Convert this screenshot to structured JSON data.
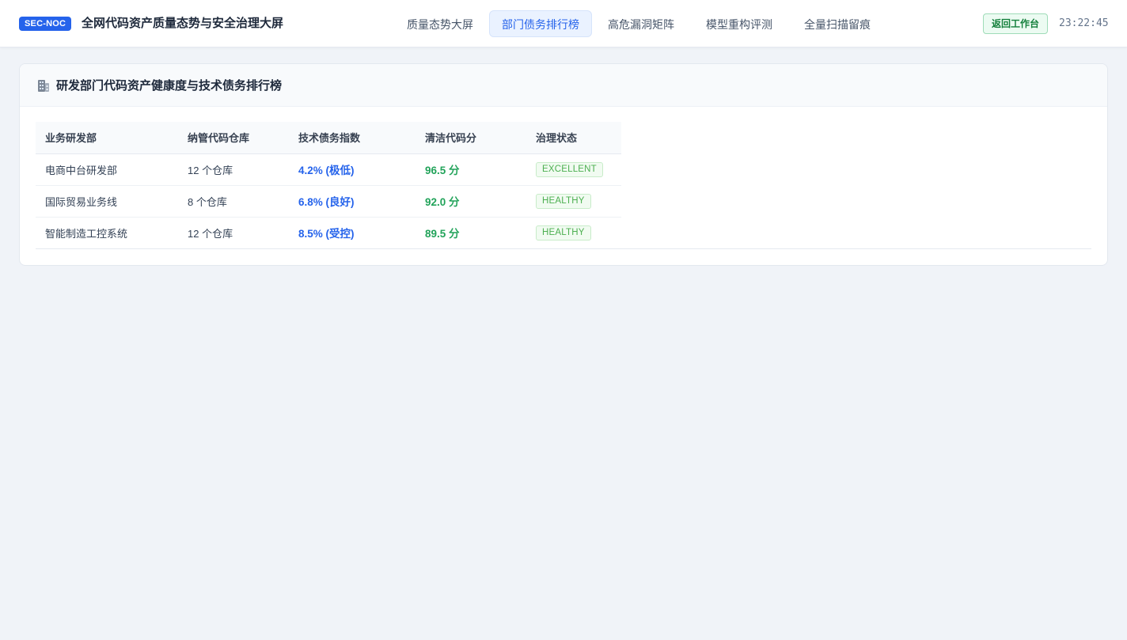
{
  "header": {
    "badge": "SEC-NOC",
    "title": "全网代码资产质量态势与安全治理大屏",
    "tabs": [
      {
        "label": "质量态势大屏",
        "active": false
      },
      {
        "label": "部门债务排行榜",
        "active": true
      },
      {
        "label": "高危漏洞矩阵",
        "active": false
      },
      {
        "label": "模型重构评测",
        "active": false
      },
      {
        "label": "全量扫描留痕",
        "active": false
      }
    ],
    "return_label": "返回工作台",
    "clock": "23:22:45"
  },
  "card": {
    "icon": "building-icon",
    "title": "研发部门代码资产健康度与技术债务排行榜"
  },
  "table": {
    "columns": [
      "业务研发部",
      "纳管代码仓库",
      "技术债务指数",
      "清洁代码分",
      "治理状态"
    ],
    "rows": [
      {
        "dept": "电商中台研发部",
        "repos": "12 个仓库",
        "debt": "4.2% (极低)",
        "score": "96.5 分",
        "status": "EXCELLENT"
      },
      {
        "dept": "国际贸易业务线",
        "repos": "8 个仓库",
        "debt": "6.8% (良好)",
        "score": "92.0 分",
        "status": "HEALTHY"
      },
      {
        "dept": "智能制造工控系统",
        "repos": "12 个仓库",
        "debt": "8.5% (受控)",
        "score": "89.5 分",
        "status": "HEALTHY"
      }
    ]
  },
  "colors": {
    "accent": "#2563eb",
    "success": "#22a35a",
    "background": "#f0f3f8"
  }
}
